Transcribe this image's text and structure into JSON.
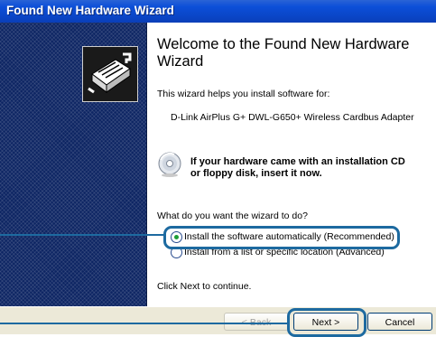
{
  "window": {
    "title": "Found New Hardware Wizard"
  },
  "wizard": {
    "heading": "Welcome to the Found New Hardware Wizard",
    "intro": "This wizard helps you install software for:",
    "device": "D-Link AirPlus G+ DWL-G650+ Wireless Cardbus Adapter",
    "cd_prompt_line1": "If your hardware came with an installation CD",
    "cd_prompt_line2": "or floppy disk, insert it now.",
    "question": "What do you want the wizard to do?",
    "option_auto": "Install the software automatically (Recommended)",
    "option_manual": "Install from a list or specific location (Advanced)",
    "selected_option": "option_auto",
    "footer_hint": "Click Next to continue."
  },
  "buttons": {
    "back": "< Back",
    "next": "Next >",
    "cancel": "Cancel"
  },
  "colors": {
    "titlebar": "#0a46c8",
    "highlight": "#1d6aa0",
    "radio_selected": "#1e9e36"
  }
}
